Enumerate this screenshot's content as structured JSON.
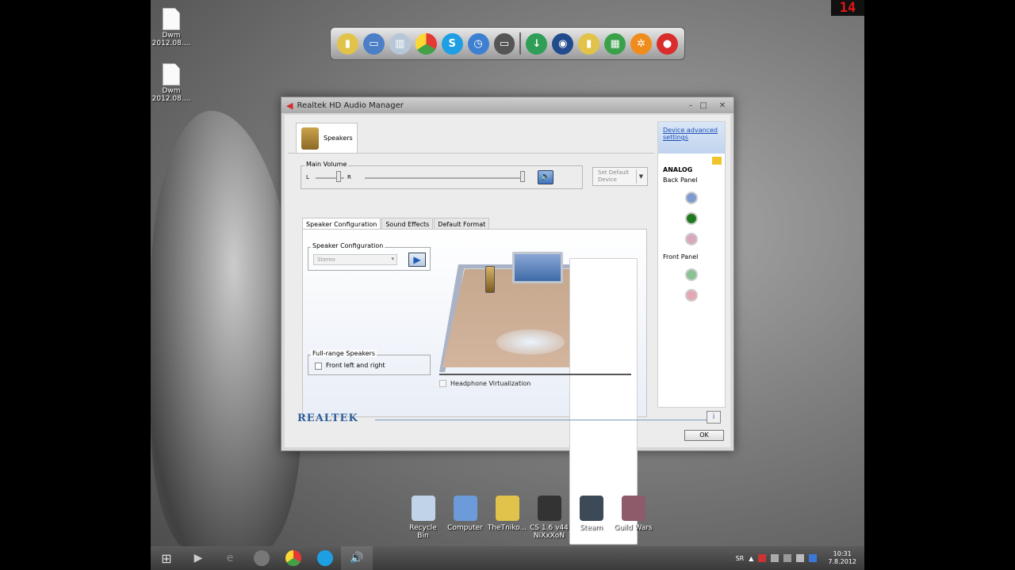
{
  "overlay": {
    "fps": "14"
  },
  "desktop_files": [
    {
      "name": "Dwm",
      "date": "2012.08...."
    },
    {
      "name": "Dwm",
      "date": "2012.08...."
    }
  ],
  "dock_icons": [
    "folder-icon",
    "computer-icon",
    "recycle-icon",
    "chrome-icon",
    "skype-icon",
    "messenger-icon",
    "monitor-icon",
    "download-icon",
    "media-icon",
    "folder-icon",
    "spreadsheet-icon",
    "tools-icon",
    "power-icon"
  ],
  "window": {
    "title": "Realtek HD Audio Manager",
    "device_tab": "Speakers",
    "main_volume": {
      "label": "Main Volume",
      "left": "L",
      "right": "R",
      "volume_level": 0.97,
      "balance_level": 0.78
    },
    "set_default": "Set Default\nDevice",
    "subtabs": [
      "Speaker Configuration",
      "Sound Effects",
      "Default Format"
    ],
    "speaker_config": {
      "legend": "Speaker Configuration",
      "value": "Stereo"
    },
    "full_range": {
      "legend": "Full-range Speakers",
      "checkbox": "Front left and right"
    },
    "headphone_virtualization": "Headphone Virtualization",
    "right_panel": {
      "advanced": "Device advanced settings",
      "analog": "ANALOG",
      "back_panel": "Back Panel",
      "front_panel": "Front Panel",
      "jack_colors": {
        "blue": "#7e9bd1",
        "green": "#1f7a1f",
        "pink": "#d8a9bd",
        "front_green": "#89c293",
        "front_pink": "#e5a7b6"
      }
    },
    "brand": "REALTEK",
    "ok": "OK"
  },
  "desktop_icons": [
    {
      "label": "Recycle\nBin",
      "color": "#c0d3e8"
    },
    {
      "label": "Computer",
      "color": "#6d9ad8"
    },
    {
      "label": "TheTniko...",
      "color": "#e1c24a"
    },
    {
      "label": "CS 1.6 v44\nNiXxXoN",
      "color": "#333333"
    },
    {
      "label": "Steam",
      "color": "#3c4a58"
    },
    {
      "label": "Guild Wars",
      "color": "#8d5b6a"
    }
  ],
  "taskbar": {
    "lang": "SR",
    "time": "10:31",
    "date": "7.8.2012"
  }
}
